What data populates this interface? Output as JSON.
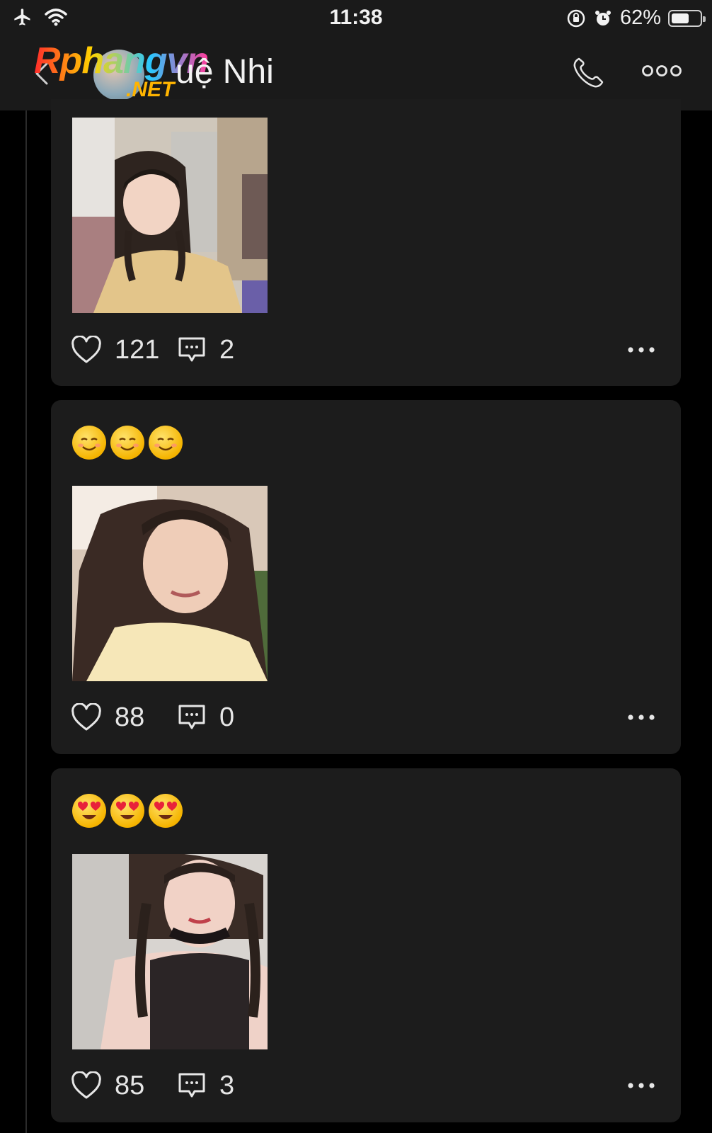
{
  "status_bar": {
    "time": "11:38",
    "battery_percent": "62%",
    "battery_level": 0.62,
    "icons": [
      "airplane-icon",
      "wifi-icon",
      "rotation-lock-icon",
      "alarm-icon",
      "battery-icon"
    ]
  },
  "header": {
    "contact_name": "uệ Nhi",
    "watermark": "Rphangvn",
    "watermark_suffix": ".NET",
    "icons": [
      "back-chevron-icon",
      "phone-icon",
      "more-icon"
    ]
  },
  "colors": {
    "background": "#000000",
    "card": "#1c1c1c",
    "header": "#1a1a1a",
    "text": "#e6e6e6"
  },
  "posts": [
    {
      "emoji_caption": "",
      "photo": "selfie-braids-yellow-dress",
      "likes": "121",
      "comments": "2"
    },
    {
      "emoji_caption": "☺☺☺",
      "photo": "selfie-long-hair",
      "likes": "88",
      "comments": "0"
    },
    {
      "emoji_caption": "😍😍😍",
      "photo": "selfie-braids-black-top",
      "likes": "85",
      "comments": "3"
    }
  ]
}
